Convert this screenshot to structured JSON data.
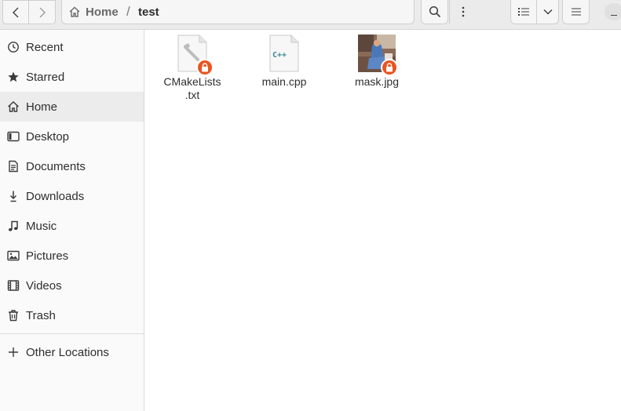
{
  "header": {
    "breadcrumb": {
      "home_label": "Home",
      "separator": "/",
      "current_label": "test"
    }
  },
  "sidebar": {
    "items": [
      {
        "label": "Recent",
        "icon": "clock-icon"
      },
      {
        "label": "Starred",
        "icon": "star-icon"
      },
      {
        "label": "Home",
        "icon": "home-icon"
      },
      {
        "label": "Desktop",
        "icon": "desktop-icon"
      },
      {
        "label": "Documents",
        "icon": "document-icon"
      },
      {
        "label": "Downloads",
        "icon": "download-icon"
      },
      {
        "label": "Music",
        "icon": "music-note-icon"
      },
      {
        "label": "Pictures",
        "icon": "picture-icon"
      },
      {
        "label": "Videos",
        "icon": "film-icon"
      },
      {
        "label": "Trash",
        "icon": "trash-icon"
      }
    ],
    "other_locations": {
      "label": "Other Locations",
      "icon": "plus-icon"
    }
  },
  "files": [
    {
      "name": "CMakeLists\n.txt",
      "type": "cmake-file",
      "locked": true
    },
    {
      "name": "main.cpp",
      "type": "cpp-source",
      "badge": "C++",
      "locked": false
    },
    {
      "name": "mask.jpg",
      "type": "image-thumbnail",
      "locked": true
    }
  ],
  "colors": {
    "accent": "#e95420",
    "selected_sidebar": "#ececec"
  }
}
